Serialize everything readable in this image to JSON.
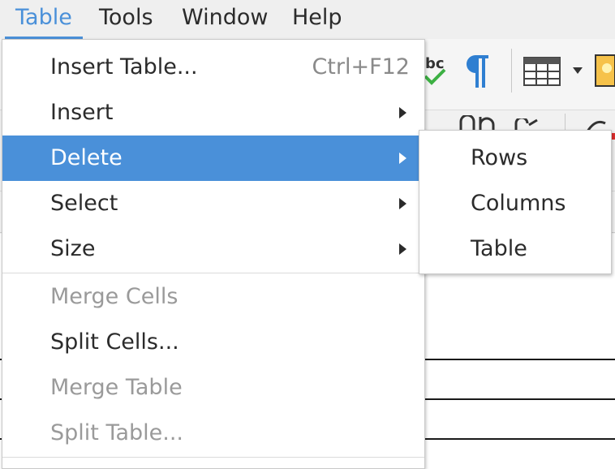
{
  "menubar": {
    "items": [
      {
        "label": "Table",
        "active": true
      },
      {
        "label": "Tools"
      },
      {
        "label": "Window"
      },
      {
        "label": "Help"
      }
    ]
  },
  "toolbar": {
    "icons": [
      "spellcheck-icon",
      "pilcrow-icon",
      "table-icon",
      "chevron-down-icon",
      "image-icon"
    ]
  },
  "table_menu": {
    "items": [
      {
        "label": "Insert Table...",
        "shortcut": "Ctrl+F12"
      },
      {
        "label": "Insert",
        "submenu": true
      },
      {
        "label": "Delete",
        "submenu": true,
        "highlighted": true
      },
      {
        "label": "Select",
        "submenu": true
      },
      {
        "label": "Size",
        "submenu": true
      },
      {
        "label": "Merge Cells",
        "disabled": true
      },
      {
        "label": "Split Cells..."
      },
      {
        "label": "Merge Table",
        "disabled": true
      },
      {
        "label": "Split Table...",
        "disabled": true
      }
    ]
  },
  "delete_submenu": {
    "items": [
      {
        "label": "Rows"
      },
      {
        "label": "Columns"
      },
      {
        "label": "Table"
      }
    ]
  },
  "colors": {
    "accent": "#4a90d9",
    "menubar_bg": "#efefef",
    "disabled_text": "#9a9a9a",
    "shortcut_text": "#8a8a8a"
  }
}
